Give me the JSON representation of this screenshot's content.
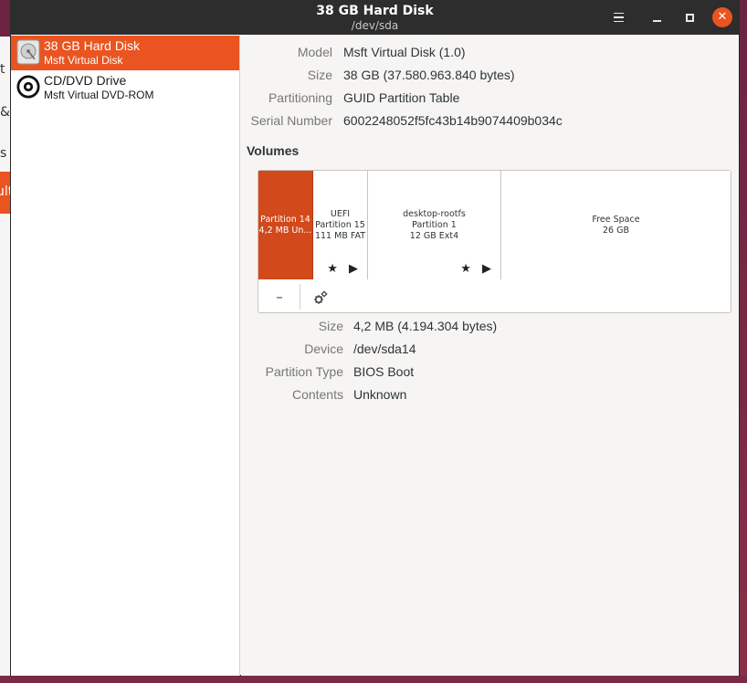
{
  "background_fragments": [
    "t",
    "&",
    "s",
    "ult"
  ],
  "window": {
    "title": "38 GB Hard Disk",
    "subtitle": "/dev/sda",
    "controls": {
      "menu_icon": "hamburger-icon",
      "minimize_icon": "minimize-icon",
      "maximize_icon": "maximize-icon",
      "close_icon": "close-icon"
    }
  },
  "sidebar": {
    "items": [
      {
        "name": "38 GB Hard Disk",
        "model": "Msft Virtual Disk",
        "icon": "hard-disk-icon",
        "selected": true
      },
      {
        "name": "CD/DVD Drive",
        "model": "Msft Virtual DVD-ROM",
        "icon": "optical-disc-icon",
        "selected": false
      }
    ]
  },
  "disk_info": [
    {
      "key": "Model",
      "value": "Msft Virtual Disk (1.0)"
    },
    {
      "key": "Size",
      "value": "38 GB (37.580.963.840 bytes)"
    },
    {
      "key": "Partitioning",
      "value": "GUID Partition Table"
    },
    {
      "key": "Serial Number",
      "value": "6002248052f5fc43b14b9074409b034c"
    }
  ],
  "volumes": {
    "title": "Volumes",
    "partitions": [
      {
        "line1": "Partition 14",
        "line2": "4,2 MB Un...",
        "selected": true
      },
      {
        "line1": "UEFI",
        "line2": "Partition 15",
        "line3": "111 MB FAT",
        "icons": "★ ▶"
      },
      {
        "line1": "desktop-rootfs",
        "line2": "Partition 1",
        "line3": "12 GB Ext4",
        "icons": "★ ▶"
      },
      {
        "line1": "Free Space",
        "line2": "26 GB"
      }
    ],
    "tools": {
      "remove": "–",
      "settings_icon": "gears-icon"
    }
  },
  "partition_info": [
    {
      "key": "Size",
      "value": "4,2 MB (4.194.304 bytes)"
    },
    {
      "key": "Device",
      "value": "/dev/sda14"
    },
    {
      "key": "Partition Type",
      "value": "BIOS Boot"
    },
    {
      "key": "Contents",
      "value": "Unknown"
    }
  ]
}
